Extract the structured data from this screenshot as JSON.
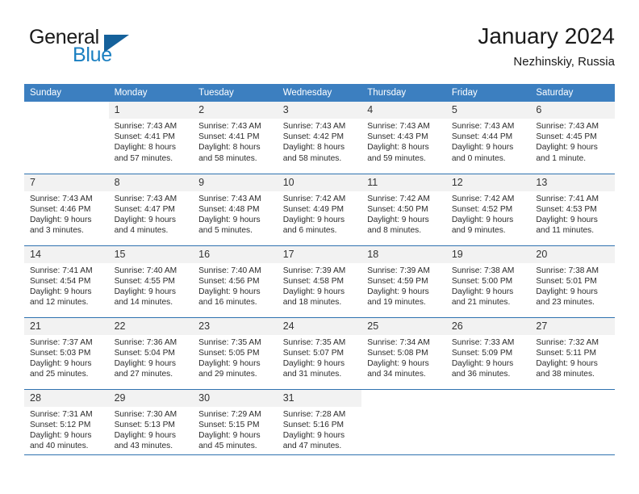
{
  "brand": {
    "name_top": "General",
    "name_bottom": "Blue",
    "triangle_icon": "brand-triangle-icon",
    "colors": {
      "blue": "#1a7fc1",
      "dark_blue": "#15619b"
    }
  },
  "header": {
    "title": "January 2024",
    "subtitle": "Nezhinskiy, Russia"
  },
  "colors": {
    "header_row_bg": "#3c7fc0",
    "header_row_text": "#ffffff",
    "daynum_bg": "#f2f2f2",
    "row_border": "#2f72b0"
  },
  "weekdays": [
    "Sunday",
    "Monday",
    "Tuesday",
    "Wednesday",
    "Thursday",
    "Friday",
    "Saturday"
  ],
  "weeks": [
    [
      {
        "day": "",
        "sunrise": "",
        "sunset": "",
        "daylight": "",
        "daylight2": ""
      },
      {
        "day": "1",
        "sunrise": "Sunrise: 7:43 AM",
        "sunset": "Sunset: 4:41 PM",
        "daylight": "Daylight: 8 hours",
        "daylight2": "and 57 minutes."
      },
      {
        "day": "2",
        "sunrise": "Sunrise: 7:43 AM",
        "sunset": "Sunset: 4:41 PM",
        "daylight": "Daylight: 8 hours",
        "daylight2": "and 58 minutes."
      },
      {
        "day": "3",
        "sunrise": "Sunrise: 7:43 AM",
        "sunset": "Sunset: 4:42 PM",
        "daylight": "Daylight: 8 hours",
        "daylight2": "and 58 minutes."
      },
      {
        "day": "4",
        "sunrise": "Sunrise: 7:43 AM",
        "sunset": "Sunset: 4:43 PM",
        "daylight": "Daylight: 8 hours",
        "daylight2": "and 59 minutes."
      },
      {
        "day": "5",
        "sunrise": "Sunrise: 7:43 AM",
        "sunset": "Sunset: 4:44 PM",
        "daylight": "Daylight: 9 hours",
        "daylight2": "and 0 minutes."
      },
      {
        "day": "6",
        "sunrise": "Sunrise: 7:43 AM",
        "sunset": "Sunset: 4:45 PM",
        "daylight": "Daylight: 9 hours",
        "daylight2": "and 1 minute."
      }
    ],
    [
      {
        "day": "7",
        "sunrise": "Sunrise: 7:43 AM",
        "sunset": "Sunset: 4:46 PM",
        "daylight": "Daylight: 9 hours",
        "daylight2": "and 3 minutes."
      },
      {
        "day": "8",
        "sunrise": "Sunrise: 7:43 AM",
        "sunset": "Sunset: 4:47 PM",
        "daylight": "Daylight: 9 hours",
        "daylight2": "and 4 minutes."
      },
      {
        "day": "9",
        "sunrise": "Sunrise: 7:43 AM",
        "sunset": "Sunset: 4:48 PM",
        "daylight": "Daylight: 9 hours",
        "daylight2": "and 5 minutes."
      },
      {
        "day": "10",
        "sunrise": "Sunrise: 7:42 AM",
        "sunset": "Sunset: 4:49 PM",
        "daylight": "Daylight: 9 hours",
        "daylight2": "and 6 minutes."
      },
      {
        "day": "11",
        "sunrise": "Sunrise: 7:42 AM",
        "sunset": "Sunset: 4:50 PM",
        "daylight": "Daylight: 9 hours",
        "daylight2": "and 8 minutes."
      },
      {
        "day": "12",
        "sunrise": "Sunrise: 7:42 AM",
        "sunset": "Sunset: 4:52 PM",
        "daylight": "Daylight: 9 hours",
        "daylight2": "and 9 minutes."
      },
      {
        "day": "13",
        "sunrise": "Sunrise: 7:41 AM",
        "sunset": "Sunset: 4:53 PM",
        "daylight": "Daylight: 9 hours",
        "daylight2": "and 11 minutes."
      }
    ],
    [
      {
        "day": "14",
        "sunrise": "Sunrise: 7:41 AM",
        "sunset": "Sunset: 4:54 PM",
        "daylight": "Daylight: 9 hours",
        "daylight2": "and 12 minutes."
      },
      {
        "day": "15",
        "sunrise": "Sunrise: 7:40 AM",
        "sunset": "Sunset: 4:55 PM",
        "daylight": "Daylight: 9 hours",
        "daylight2": "and 14 minutes."
      },
      {
        "day": "16",
        "sunrise": "Sunrise: 7:40 AM",
        "sunset": "Sunset: 4:56 PM",
        "daylight": "Daylight: 9 hours",
        "daylight2": "and 16 minutes."
      },
      {
        "day": "17",
        "sunrise": "Sunrise: 7:39 AM",
        "sunset": "Sunset: 4:58 PM",
        "daylight": "Daylight: 9 hours",
        "daylight2": "and 18 minutes."
      },
      {
        "day": "18",
        "sunrise": "Sunrise: 7:39 AM",
        "sunset": "Sunset: 4:59 PM",
        "daylight": "Daylight: 9 hours",
        "daylight2": "and 19 minutes."
      },
      {
        "day": "19",
        "sunrise": "Sunrise: 7:38 AM",
        "sunset": "Sunset: 5:00 PM",
        "daylight": "Daylight: 9 hours",
        "daylight2": "and 21 minutes."
      },
      {
        "day": "20",
        "sunrise": "Sunrise: 7:38 AM",
        "sunset": "Sunset: 5:01 PM",
        "daylight": "Daylight: 9 hours",
        "daylight2": "and 23 minutes."
      }
    ],
    [
      {
        "day": "21",
        "sunrise": "Sunrise: 7:37 AM",
        "sunset": "Sunset: 5:03 PM",
        "daylight": "Daylight: 9 hours",
        "daylight2": "and 25 minutes."
      },
      {
        "day": "22",
        "sunrise": "Sunrise: 7:36 AM",
        "sunset": "Sunset: 5:04 PM",
        "daylight": "Daylight: 9 hours",
        "daylight2": "and 27 minutes."
      },
      {
        "day": "23",
        "sunrise": "Sunrise: 7:35 AM",
        "sunset": "Sunset: 5:05 PM",
        "daylight": "Daylight: 9 hours",
        "daylight2": "and 29 minutes."
      },
      {
        "day": "24",
        "sunrise": "Sunrise: 7:35 AM",
        "sunset": "Sunset: 5:07 PM",
        "daylight": "Daylight: 9 hours",
        "daylight2": "and 31 minutes."
      },
      {
        "day": "25",
        "sunrise": "Sunrise: 7:34 AM",
        "sunset": "Sunset: 5:08 PM",
        "daylight": "Daylight: 9 hours",
        "daylight2": "and 34 minutes."
      },
      {
        "day": "26",
        "sunrise": "Sunrise: 7:33 AM",
        "sunset": "Sunset: 5:09 PM",
        "daylight": "Daylight: 9 hours",
        "daylight2": "and 36 minutes."
      },
      {
        "day": "27",
        "sunrise": "Sunrise: 7:32 AM",
        "sunset": "Sunset: 5:11 PM",
        "daylight": "Daylight: 9 hours",
        "daylight2": "and 38 minutes."
      }
    ],
    [
      {
        "day": "28",
        "sunrise": "Sunrise: 7:31 AM",
        "sunset": "Sunset: 5:12 PM",
        "daylight": "Daylight: 9 hours",
        "daylight2": "and 40 minutes."
      },
      {
        "day": "29",
        "sunrise": "Sunrise: 7:30 AM",
        "sunset": "Sunset: 5:13 PM",
        "daylight": "Daylight: 9 hours",
        "daylight2": "and 43 minutes."
      },
      {
        "day": "30",
        "sunrise": "Sunrise: 7:29 AM",
        "sunset": "Sunset: 5:15 PM",
        "daylight": "Daylight: 9 hours",
        "daylight2": "and 45 minutes."
      },
      {
        "day": "31",
        "sunrise": "Sunrise: 7:28 AM",
        "sunset": "Sunset: 5:16 PM",
        "daylight": "Daylight: 9 hours",
        "daylight2": "and 47 minutes."
      },
      {
        "day": "",
        "sunrise": "",
        "sunset": "",
        "daylight": "",
        "daylight2": ""
      },
      {
        "day": "",
        "sunrise": "",
        "sunset": "",
        "daylight": "",
        "daylight2": ""
      },
      {
        "day": "",
        "sunrise": "",
        "sunset": "",
        "daylight": "",
        "daylight2": ""
      }
    ]
  ]
}
